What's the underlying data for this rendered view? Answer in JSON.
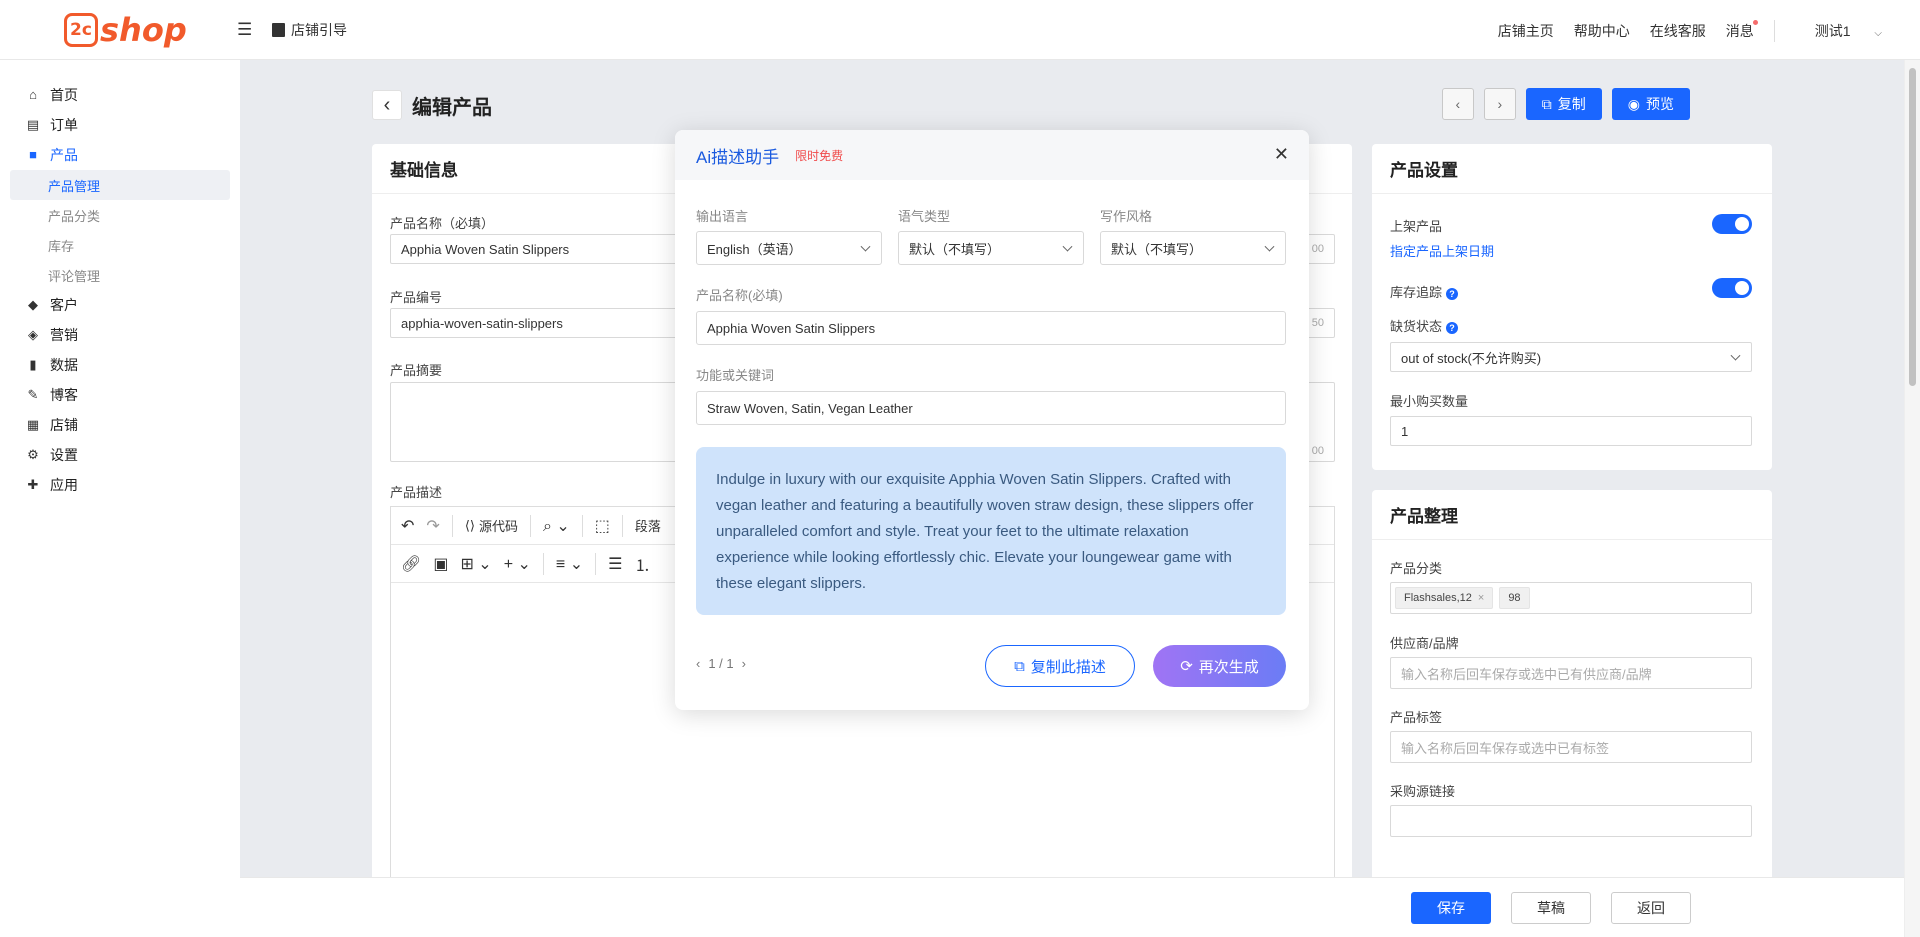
{
  "topbar": {
    "logo_mark": "2c",
    "logo_text": "shop",
    "guide_label": "店铺引导",
    "links": [
      "店铺主页",
      "帮助中心",
      "在线客服",
      "消息"
    ],
    "user": "测试1"
  },
  "sidebar": {
    "items": [
      {
        "label": "首页"
      },
      {
        "label": "订单"
      },
      {
        "label": "产品"
      },
      {
        "label": "产品管理"
      },
      {
        "label": "产品分类"
      },
      {
        "label": "库存"
      },
      {
        "label": "评论管理"
      },
      {
        "label": "客户"
      },
      {
        "label": "营销"
      },
      {
        "label": "数据"
      },
      {
        "label": "博客"
      },
      {
        "label": "店铺"
      },
      {
        "label": "设置"
      },
      {
        "label": "应用"
      }
    ]
  },
  "page": {
    "title": "编辑产品",
    "copy_label": "复制",
    "preview_label": "预览"
  },
  "basic": {
    "title": "基础信息",
    "name_label": "产品名称（必填）",
    "name_value": "Apphia Woven Satin Slippers",
    "name_count": "00",
    "sku_label": "产品编号",
    "sku_value": "apphia-woven-satin-slippers",
    "sku_count": "50",
    "summary_label": "产品摘要",
    "summary_count": "00",
    "desc_label": "产品描述",
    "source_label": "源代码",
    "paragraph_label": "段落"
  },
  "settings": {
    "title": "产品设置",
    "publish_label": "上架产品",
    "schedule_link": "指定产品上架日期",
    "track_label": "库存追踪",
    "stock_status_label": "缺货状态",
    "stock_status_value": "out of stock(不允许购买)",
    "min_qty_label": "最小购买数量",
    "min_qty_value": "1"
  },
  "organize": {
    "title": "产品整理",
    "category_label": "产品分类",
    "tags": [
      "Flashsales,12",
      "98"
    ],
    "vendor_label": "供应商/品牌",
    "vendor_placeholder": "输入名称后回车保存或选中已有供应商/品牌",
    "tag_label": "产品标签",
    "tag_placeholder": "输入名称后回车保存或选中已有标签",
    "source_label": "采购源链接"
  },
  "footer": {
    "save": "保存",
    "draft": "草稿",
    "back": "返回"
  },
  "modal": {
    "title": "Ai描述助手",
    "badge": "限时免费",
    "lang_label": "输出语言",
    "lang_value": "English（英语）",
    "tone_label": "语气类型",
    "tone_value": "默认（不填写）",
    "style_label": "写作风格",
    "style_value": "默认（不填写）",
    "name_label": "产品名称(必填)",
    "name_value": "Apphia Woven Satin Slippers",
    "keywords_label": "功能或关键词",
    "keywords_value": "Straw Woven, Satin, Vegan Leather",
    "output": "Indulge in luxury with our exquisite Apphia Woven Satin Slippers. Crafted with vegan leather and featuring a beautifully woven straw design, these slippers offer unparalleled comfort and style. Treat your feet to the ultimate relaxation experience while looking effortlessly chic. Elevate your loungewear game with these elegant slippers.",
    "pager": "1 / 1",
    "copy_label": "复制此描述",
    "regen_label": "再次生成"
  },
  "colors": {
    "primary": "#1a66ff",
    "brand": "#f15a2b",
    "ai_box": "#cfe3fb",
    "badge": "#f04b4b"
  }
}
